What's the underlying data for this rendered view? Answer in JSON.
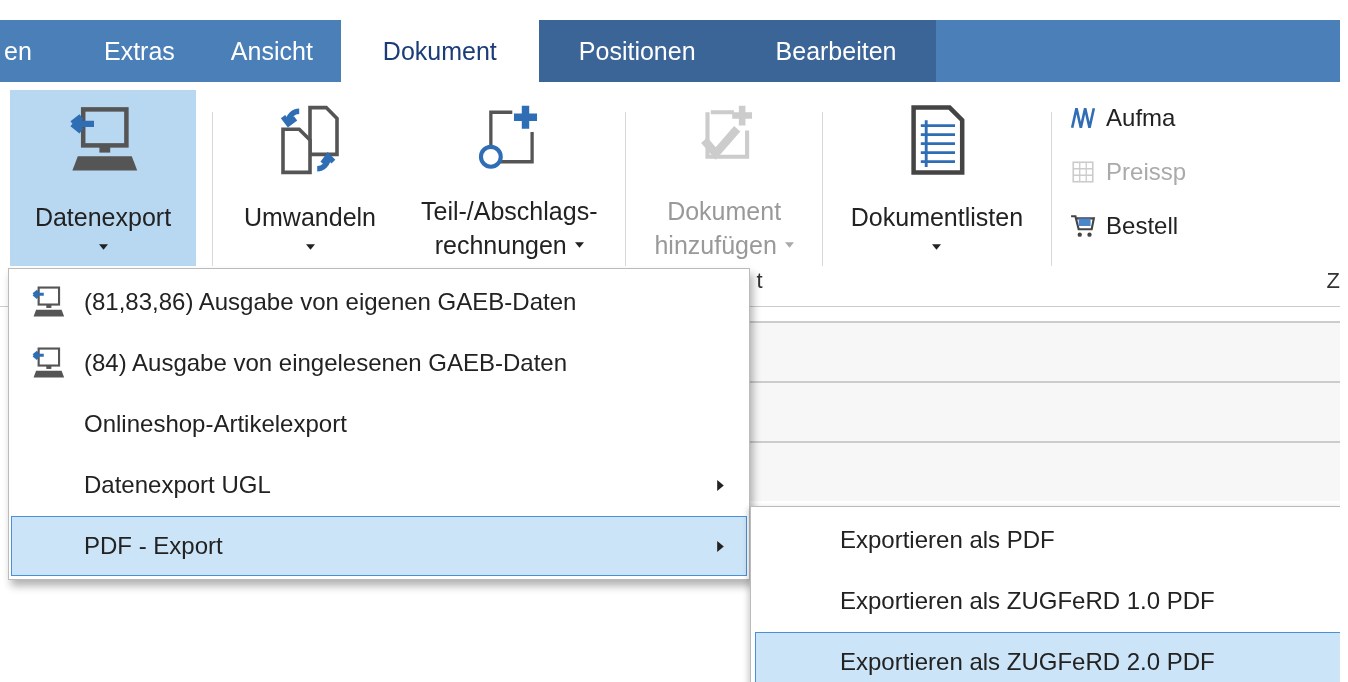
{
  "tabs": [
    {
      "label": "en",
      "selected": false,
      "contextual": false
    },
    {
      "label": "Extras",
      "selected": false,
      "contextual": false
    },
    {
      "label": "Ansicht",
      "selected": false,
      "contextual": false
    },
    {
      "label": "Dokument",
      "selected": true,
      "contextual": false
    },
    {
      "label": "Positionen",
      "selected": false,
      "contextual": true
    },
    {
      "label": "Bearbeiten",
      "selected": false,
      "contextual": true
    }
  ],
  "ribbon": {
    "groups": [
      {
        "buttons": [
          {
            "lines": [
              "Datenexport"
            ],
            "kind": "export",
            "selected": true,
            "disabled": false,
            "caret_inline": false
          }
        ]
      },
      {
        "buttons": [
          {
            "lines": [
              "Umwandeln"
            ],
            "kind": "convert",
            "selected": false,
            "disabled": false,
            "caret_inline": false
          },
          {
            "lines": [
              "Teil-/Abschlags-",
              "rechnungen"
            ],
            "kind": "invoice",
            "selected": false,
            "disabled": false,
            "caret_inline": true
          }
        ]
      },
      {
        "label": "t",
        "buttons": [
          {
            "lines": [
              "Dokument",
              "hinzufügen"
            ],
            "kind": "add-document",
            "selected": false,
            "disabled": true,
            "caret_inline": true
          }
        ]
      },
      {
        "buttons": [
          {
            "lines": [
              "Dokumentlisten"
            ],
            "kind": "list",
            "selected": false,
            "disabled": false,
            "caret_inline": false
          }
        ]
      }
    ],
    "small_buttons": [
      {
        "label": "Aufma",
        "kind": "measure",
        "disabled": false
      },
      {
        "label": "Preissp",
        "kind": "grid",
        "disabled": true
      },
      {
        "label": "Bestell",
        "kind": "cart",
        "disabled": false
      }
    ],
    "small_group_label": "Z"
  },
  "menu": {
    "items": [
      {
        "label": "(81,83,86) Ausgabe von eigenen GAEB-Daten",
        "icon": true,
        "submenu": false,
        "selected": false
      },
      {
        "label": "(84) Ausgabe von eingelesenen GAEB-Daten",
        "icon": true,
        "submenu": false,
        "selected": false
      },
      {
        "label": "Onlineshop-Artikelexport",
        "icon": false,
        "submenu": false,
        "selected": false
      },
      {
        "label": "Datenexport UGL",
        "icon": false,
        "submenu": true,
        "selected": false
      },
      {
        "label": "PDF - Export",
        "icon": false,
        "submenu": true,
        "selected": true
      }
    ]
  },
  "submenu": {
    "items": [
      {
        "label": "Exportieren als PDF",
        "selected": false
      },
      {
        "label": "Exportieren als ZUGFeRD 1.0 PDF",
        "selected": false
      },
      {
        "label": "Exportieren als ZUGFeRD 2.0 PDF",
        "selected": true
      }
    ]
  }
}
